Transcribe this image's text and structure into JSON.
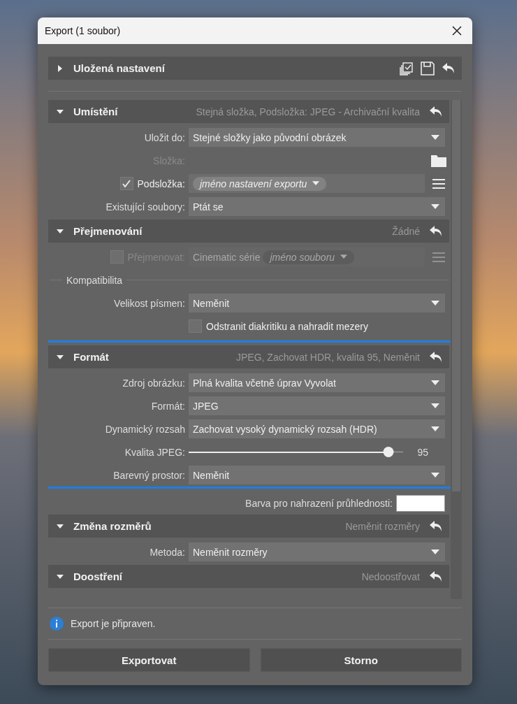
{
  "window": {
    "title": "Export (1 soubor)"
  },
  "presets": {
    "title": "Uložená nastavení",
    "expanded": false
  },
  "sections": [
    {
      "title": "Umístění",
      "summary": "Stejná složka, Podsložka: JPEG - Archivační kvalita",
      "expanded": true,
      "highlighted": false,
      "rows": [
        {
          "kind": "dropdown",
          "label": "Uložit do:",
          "value": "Stejné složky jako původní obrázek"
        },
        {
          "kind": "folder",
          "label": "Složka:",
          "disabled": true
        },
        {
          "kind": "token",
          "label": "Podsložka:",
          "checked": true,
          "disabled": false,
          "token": "jméno nastavení exportu"
        },
        {
          "kind": "dropdown",
          "label": "Existující soubory:",
          "value": "Ptát se"
        }
      ]
    },
    {
      "title": "Přejmenování",
      "summary": "Žádné",
      "expanded": true,
      "highlighted": false,
      "rows": [
        {
          "kind": "token",
          "label": "Přejmenovat:",
          "checked": false,
          "disabled": true,
          "prefix": "Cinematic série",
          "token": "jméno souboru"
        },
        {
          "kind": "group",
          "label": "Kompatibilita"
        },
        {
          "kind": "dropdown",
          "label": "Velikost písmen:",
          "value": "Neměnit"
        },
        {
          "kind": "checkbox",
          "label": "Odstranit diakritiku a nahradit mezery",
          "checked": false
        }
      ]
    },
    {
      "title": "Formát",
      "summary": "JPEG, Zachovat HDR, kvalita 95, Neměnit",
      "expanded": true,
      "highlighted": true,
      "rows": [
        {
          "kind": "dropdown",
          "label": "Zdroj obrázku:",
          "value": "Plná kvalita včetně úprav Vyvolat"
        },
        {
          "kind": "dropdown",
          "label": "Formát:",
          "value": "JPEG"
        },
        {
          "kind": "dropdown",
          "label": "Dynamický rozsah",
          "value": "Zachovat vysoký dynamický rozsah (HDR)"
        },
        {
          "kind": "slider",
          "label": "Kvalita JPEG:",
          "level": 0.93,
          "reading": "95"
        },
        {
          "kind": "dropdown",
          "label": "Barevný prostor:",
          "value": "Neměnit"
        }
      ],
      "footer_rows": [
        {
          "kind": "color",
          "label": "Barva pro nahrazení průhlednosti:",
          "color": "#ffffff"
        }
      ]
    },
    {
      "title": "Změna rozměrů",
      "summary": "Neměnit rozměry",
      "expanded": true,
      "highlighted": false,
      "rows": [
        {
          "kind": "dropdown",
          "label": "Metoda:",
          "value": "Neměnit rozměry"
        }
      ]
    },
    {
      "title": "Doostření",
      "summary": "Nedoostřovat",
      "expanded": true,
      "highlighted": false
    }
  ],
  "status": {
    "text": "Export je připraven."
  },
  "buttons": [
    {
      "label": "Exportovat"
    },
    {
      "label": "Storno"
    }
  ]
}
